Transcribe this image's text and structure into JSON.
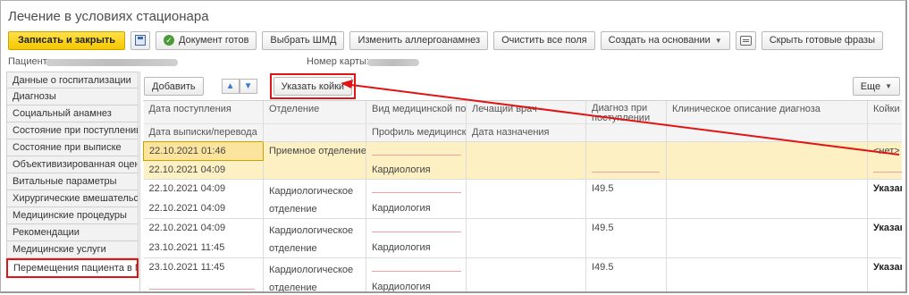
{
  "window": {
    "title": "Лечение в условиях стационара"
  },
  "toolbar": {
    "save_close": "Записать и закрыть",
    "doc_ready": "Документ готов",
    "choose_shmd": "Выбрать ШМД",
    "change_allergy": "Изменить аллергоанамнез",
    "clear_fields": "Очистить все поля",
    "create_based": "Создать на основании",
    "hide_phrases": "Скрыть готовые фразы"
  },
  "patient": {
    "label": "Пациент:",
    "card_label": "Номер карты:"
  },
  "sidebar": {
    "items": [
      {
        "label": "Данные о госпитализации"
      },
      {
        "label": "Диагнозы"
      },
      {
        "label": "Социальный анамнез"
      },
      {
        "label": "Состояние при поступлении"
      },
      {
        "label": "Состояние при выписке"
      },
      {
        "label": "Объективизированная оценка"
      },
      {
        "label": "Витальные параметры"
      },
      {
        "label": "Хирургические вмешательства"
      },
      {
        "label": "Медицинские процедуры"
      },
      {
        "label": "Рекомендации"
      },
      {
        "label": "Медицинские услуги"
      },
      {
        "label": "Перемещения пациента в МО"
      }
    ]
  },
  "content_toolbar": {
    "add": "Добавить",
    "specify_beds": "Указать койки",
    "more": "Еще"
  },
  "table": {
    "headers_top": [
      "Дата поступления",
      "Отделение",
      "Вид медицинской по...",
      "Лечащий врач",
      "Диагноз при поступлении",
      "Клиническое описание диагноза",
      "Койки"
    ],
    "headers_bottom": [
      "Дата выписки/перевода",
      "",
      "Профиль медицинской",
      "Дата назначения",
      "",
      "",
      ""
    ],
    "rows": [
      {
        "date_in": "22.10.2021 01:46",
        "date_out": "22.10.2021 04:09",
        "dept": "Приемное отделение",
        "profile": "Кардиология",
        "diag": "",
        "beds": "<нет>"
      },
      {
        "date_in": "22.10.2021 04:09",
        "date_out": "22.10.2021 04:09",
        "dept": "Кардиологическое отделение",
        "profile": "Кардиология",
        "diag": "I49.5",
        "beds": "Указаны"
      },
      {
        "date_in": "22.10.2021 04:09",
        "date_out": "23.10.2021 11:45",
        "dept": "Кардиологическое отделение",
        "profile": "Кардиология",
        "diag": "I49.5",
        "beds": "Указаны"
      },
      {
        "date_in": "23.10.2021 11:45",
        "date_out": "",
        "dept": "Кардиологическое отделение",
        "profile": "Кардиология",
        "diag": "I49.5",
        "beds": "Указаны"
      }
    ]
  },
  "colors": {
    "accent": "#f5c800",
    "annotation": "#e01414",
    "selected_row": "#fdf1c4"
  },
  "icons": {
    "save": "save-icon",
    "ok": "check-circle-icon",
    "comment": "comment-icon",
    "up": "arrow-up-icon",
    "down": "arrow-down-icon"
  }
}
